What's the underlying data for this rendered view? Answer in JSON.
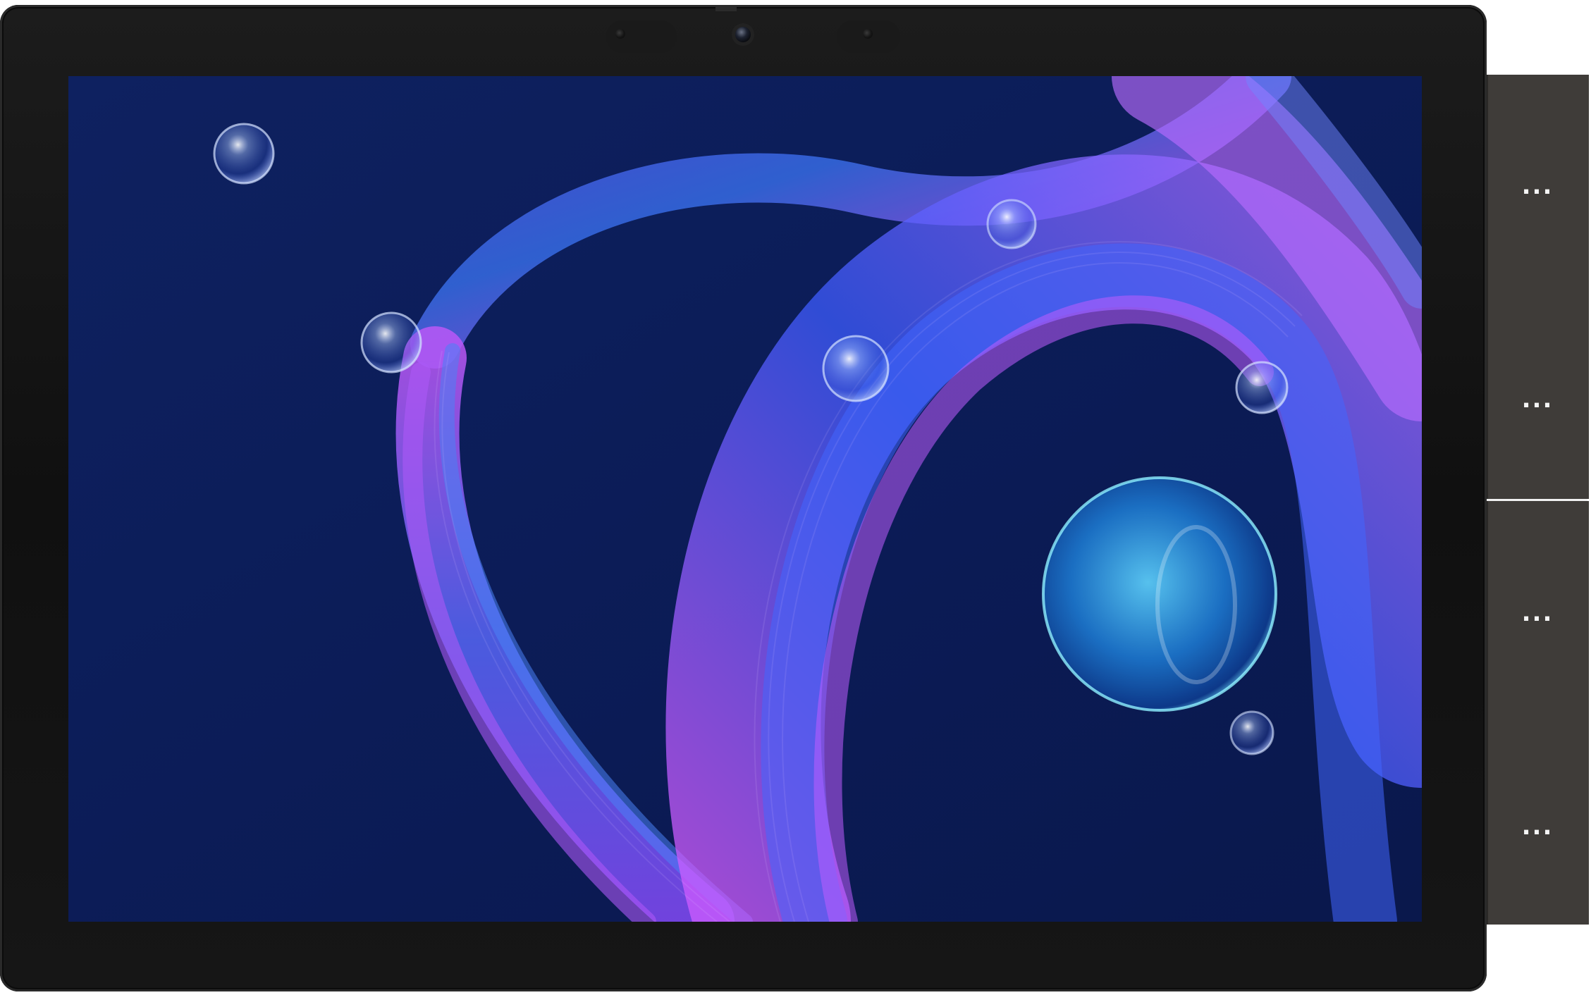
{
  "colors": {
    "bezel": "#121212",
    "screen_background": "#0d1f5c",
    "ribbon_violet": "#8a4dff",
    "ribbon_blue": "#3f7bff",
    "ribbon_magenta": "#c05cff",
    "side_panel": "#3d3a37"
  },
  "device": {
    "camera_icon": "front-camera-icon",
    "sensor_icon": "sensor-icon"
  },
  "wallpaper": {
    "kind": "abstract-ribbon-bubbles"
  },
  "side_panel": {
    "buttons": [
      {
        "label": "...",
        "icon": "more-options-icon"
      },
      {
        "label": "...",
        "icon": "more-options-icon"
      },
      {
        "label": "...",
        "icon": "more-options-icon"
      },
      {
        "label": "...",
        "icon": "more-options-icon"
      }
    ]
  }
}
